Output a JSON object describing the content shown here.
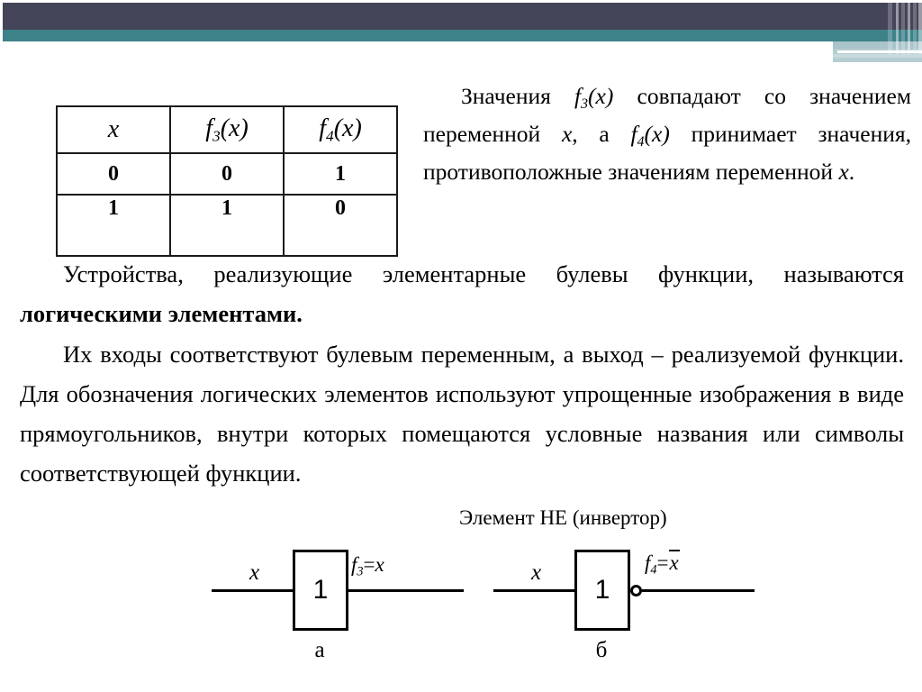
{
  "theme": {
    "navy": "#454559",
    "teal": "#3d8289",
    "light_blue": "#a9c4cb",
    "background": "#ffffff",
    "text": "#000000"
  },
  "truth_table": {
    "headers": [
      "x",
      "f3(x)",
      "f4(x)"
    ],
    "header_display": [
      {
        "base": "x",
        "sub": "",
        "paren": ""
      },
      {
        "base": "f",
        "sub": "3",
        "paren": "(x)"
      },
      {
        "base": "f",
        "sub": "4",
        "paren": "(x)"
      }
    ],
    "rows": [
      [
        "0",
        "0",
        "1"
      ],
      [
        "1",
        "1",
        "0"
      ]
    ]
  },
  "intro": {
    "text": "Значения f3(x) совпадают со значением переменной x, а f4(x) принимает значения, противоположные значениям переменной x."
  },
  "body": {
    "paragraph_devices_part1": "Устройства, реализующие элементарные булевы функции, называются ",
    "paragraph_devices_bold": "логическими элементами.",
    "paragraph_inputs": "Их входы соответствуют булевым переменным, а выход – реализуемой функции. Для обозначения логических элементов используют упрощенные изображения в виде прямоугольников, внутри которых помещаются условные названия или символы соответствующей функции."
  },
  "gates": {
    "section_title": "Элемент НЕ (инвертор)",
    "a": {
      "input_label": "x",
      "box_symbol": "1",
      "output_prefix": "f",
      "output_sub": "3",
      "output_eq": "=",
      "output_value": "x",
      "caption": "а",
      "inverted": false
    },
    "b": {
      "input_label": "x",
      "box_symbol": "1",
      "output_prefix": "f",
      "output_sub": "4",
      "output_eq": "=",
      "output_value": "x",
      "caption": "б",
      "inverted": true
    }
  }
}
